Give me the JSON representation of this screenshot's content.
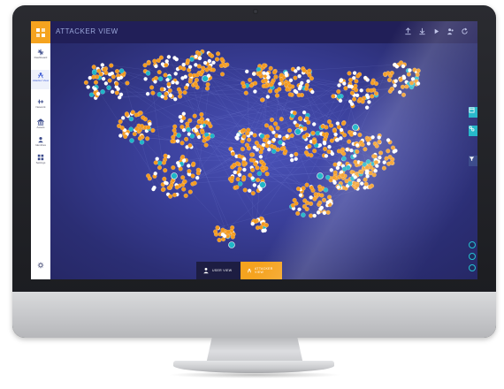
{
  "app": {
    "title": "ATTACKER VIEW"
  },
  "sidebar": {
    "items": [
      {
        "label": "Dashboard",
        "icon": "overview-icon"
      },
      {
        "label": "Attacker View",
        "icon": "attacker-view-icon",
        "active": true
      },
      {
        "label": "Network",
        "icon": "network-icon"
      },
      {
        "label": "Assets",
        "icon": "assets-icon"
      },
      {
        "label": "Identities",
        "icon": "identities-icon"
      },
      {
        "label": "Settings",
        "icon": "settings-list-icon"
      }
    ]
  },
  "toolbar": {
    "icons": [
      "upload-icon",
      "download-icon",
      "play-icon",
      "people-icon",
      "refresh-icon"
    ]
  },
  "right_tabs": [
    "layout-icon",
    "link-icon",
    "filter-icon"
  ],
  "bottom_bar": {
    "user_view_label": "USER VIEW",
    "attacker_view_label": "ATTACKER VIEW"
  },
  "colors": {
    "accent": "#f5a31f",
    "teal": "#1fb6c8",
    "header": "#211f58",
    "canvas": "#3a3f99",
    "node_orange": "#f39a1f",
    "node_white": "#ffffff",
    "node_teal": "#1fb6c8"
  },
  "graph": {
    "clusters": 20,
    "node_types": [
      "asset",
      "identity",
      "attack-path"
    ]
  }
}
